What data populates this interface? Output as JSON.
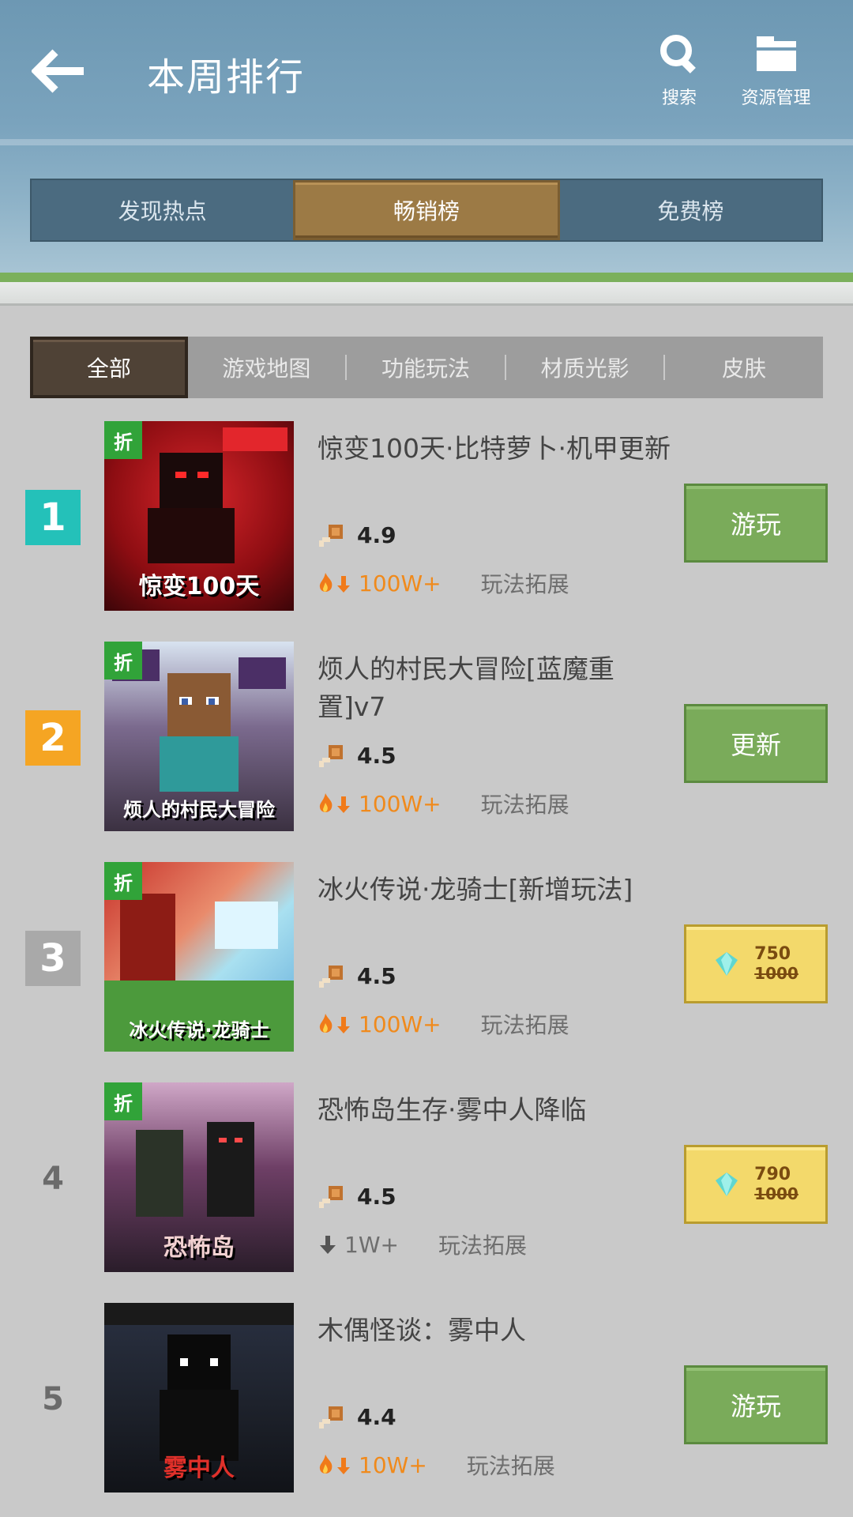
{
  "header": {
    "title": "本周排行",
    "search_label": "搜索",
    "resources_label": "资源管理"
  },
  "main_tabs": [
    {
      "label": "发现热点",
      "active": false
    },
    {
      "label": "畅销榜",
      "active": true
    },
    {
      "label": "免费榜",
      "active": false
    }
  ],
  "sub_tabs": [
    {
      "label": "全部",
      "active": true
    },
    {
      "label": "游戏地图",
      "active": false
    },
    {
      "label": "功能玩法",
      "active": false
    },
    {
      "label": "材质光影",
      "active": false
    },
    {
      "label": "皮肤",
      "active": false
    }
  ],
  "items": [
    {
      "rank": "1",
      "discount_tag": "折",
      "title": "惊变100天·比特萝卜·机甲更新",
      "cover_text": "惊变100天",
      "rating": "4.9",
      "downloads": "100W+",
      "trend": "hot",
      "category": "玩法拓展",
      "action_label": "游玩"
    },
    {
      "rank": "2",
      "discount_tag": "折",
      "title": "烦人的村民大冒险[蓝魔重置]v7",
      "cover_text": "烦人的村民大冒险",
      "rating": "4.5",
      "downloads": "100W+",
      "trend": "hot",
      "category": "玩法拓展",
      "action_label": "更新"
    },
    {
      "rank": "3",
      "discount_tag": "折",
      "title": "冰火传说·龙骑士[新增玩法]",
      "cover_text": "冰火传说·龙骑士",
      "rating": "4.5",
      "downloads": "100W+",
      "trend": "hot",
      "category": "玩法拓展",
      "price_now": "750",
      "price_old": "1000"
    },
    {
      "rank": "4",
      "discount_tag": "折",
      "title": "恐怖岛生存·雾中人降临",
      "cover_text": "恐怖岛",
      "rating": "4.5",
      "downloads": "1W+",
      "trend": "down",
      "category": "玩法拓展",
      "price_now": "790",
      "price_old": "1000"
    },
    {
      "rank": "5",
      "discount_tag": "",
      "title": "木偶怪谈：雾中人",
      "cover_text": "雾中人",
      "rating": "4.4",
      "downloads": "10W+",
      "trend": "hot",
      "category": "玩法拓展",
      "action_label": "游玩"
    }
  ],
  "colors": {
    "header": "#7aa3bd",
    "active_main_tab": "#9c7a45",
    "play_button": "#7aab5a",
    "price_button": "#f3d96b",
    "discount_tag": "#31a339",
    "downloads_hot": "#f08a1c"
  }
}
